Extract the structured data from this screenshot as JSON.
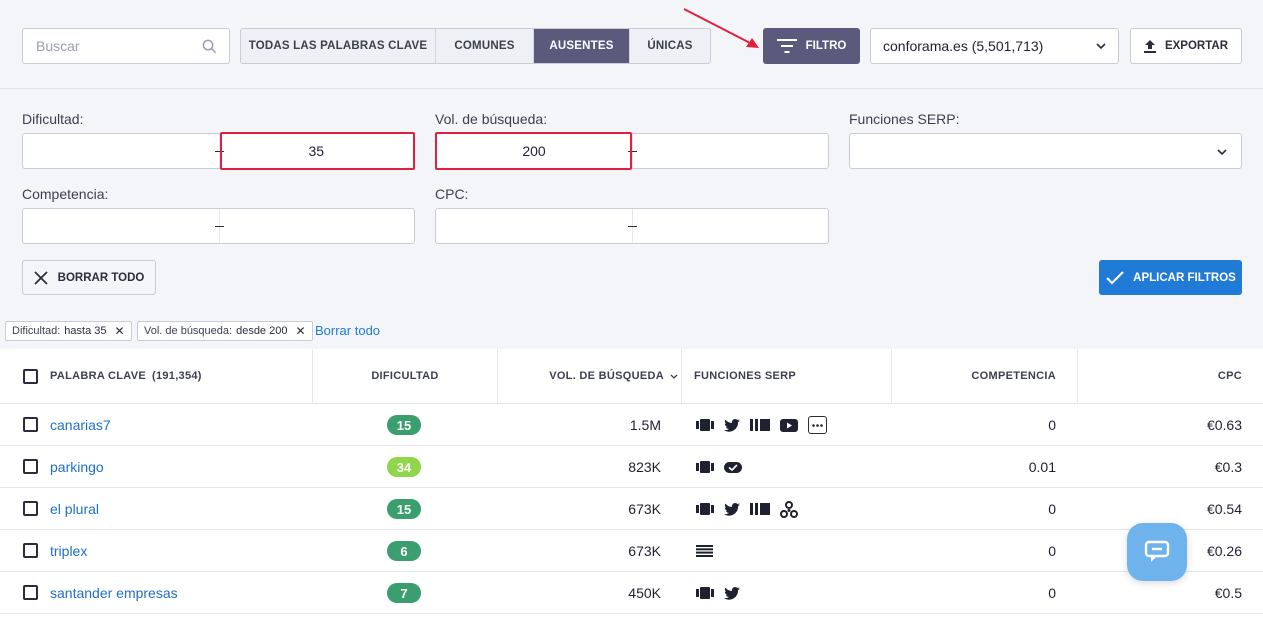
{
  "toolbar": {
    "search_placeholder": "Buscar",
    "tabs": [
      {
        "label": "TODAS LAS PALABRAS CLAVE",
        "active": false
      },
      {
        "label": "COMUNES",
        "active": false
      },
      {
        "label": "AUSENTES",
        "active": true
      },
      {
        "label": "ÚNICAS",
        "active": false
      }
    ],
    "filter_label": "FILTRO",
    "domain_select": "conforama.es (5,501,713)",
    "export_label": "EXPORTAR"
  },
  "filters": {
    "difficulty": {
      "label": "Dificultad:",
      "from": "",
      "to": "35"
    },
    "volume": {
      "label": "Vol. de búsqueda:",
      "from": "200",
      "to": ""
    },
    "serp": {
      "label": "Funciones SERP:",
      "value": ""
    },
    "competition": {
      "label": "Competencia:",
      "from": "",
      "to": ""
    },
    "cpc": {
      "label": "CPC:",
      "from": "",
      "to": ""
    },
    "clear_all_label": "BORRAR TODO",
    "apply_label": "APLICAR FILTROS"
  },
  "active_filters": {
    "chips": [
      {
        "key": "Dificultad:",
        "value": "hasta 35"
      },
      {
        "key": "Vol. de búsqueda:",
        "value": "desde 200"
      }
    ],
    "clear_link": "Borrar todo"
  },
  "table": {
    "headers": {
      "keyword": "PALABRA CLAVE",
      "keyword_count": "(191,354)",
      "difficulty": "DIFICULTAD",
      "volume": "VOL. DE BÚSQUEDA",
      "serp": "FUNCIONES SERP",
      "competition": "COMPETENCIA",
      "cpc": "CPC"
    },
    "rows": [
      {
        "keyword": "canarias7",
        "difficulty": "15",
        "difficulty_color": "#3a9e6e",
        "volume": "1.5M",
        "serp": [
          "carousel-icon",
          "twitter-icon",
          "image-pack-icon",
          "video-icon",
          "more-icon"
        ],
        "competition": "0",
        "cpc": "€0.63"
      },
      {
        "keyword": "parkingo",
        "difficulty": "34",
        "difficulty_color": "#8fd64a",
        "volume": "823K",
        "serp": [
          "carousel-icon",
          "reviews-icon"
        ],
        "competition": "0.01",
        "cpc": "€0.3"
      },
      {
        "keyword": "el plural",
        "difficulty": "15",
        "difficulty_color": "#3a9e6e",
        "volume": "673K",
        "serp": [
          "carousel-icon",
          "twitter-icon",
          "image-pack-icon",
          "knowledge-graph-icon"
        ],
        "competition": "0",
        "cpc": "€0.54"
      },
      {
        "keyword": "triplex",
        "difficulty": "6",
        "difficulty_color": "#3a9e6e",
        "volume": "673K",
        "serp": [
          "sitelinks-icon"
        ],
        "competition": "0",
        "cpc": "€0.26"
      },
      {
        "keyword": "santander empresas",
        "difficulty": "7",
        "difficulty_color": "#3a9e6e",
        "volume": "450K",
        "serp": [
          "carousel-icon",
          "twitter-icon"
        ],
        "competition": "0",
        "cpc": "€0.5"
      }
    ]
  },
  "colors": {
    "accent": "#5b5a7c",
    "primary_button": "#1f7bd6",
    "highlight": "#e0203f",
    "link": "#1f6fc9"
  }
}
